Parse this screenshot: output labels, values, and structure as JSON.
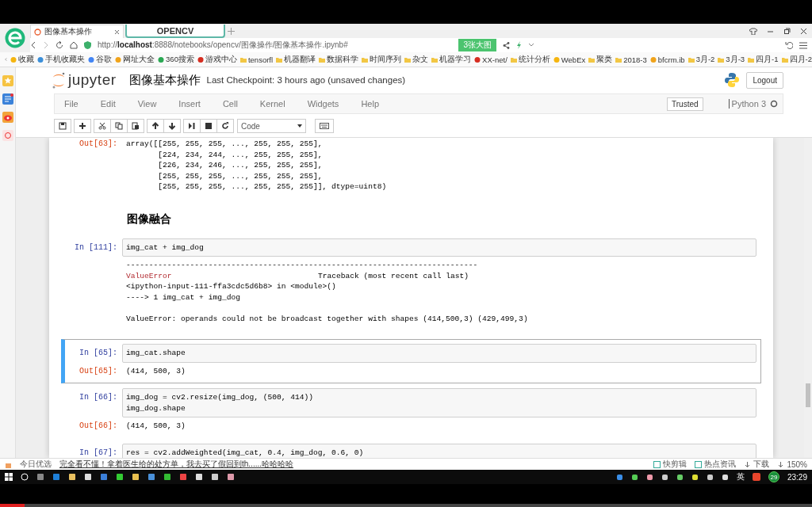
{
  "browser": {
    "tabs": [
      {
        "title": "图像基本操作",
        "selected": true
      }
    ],
    "overlay_label": "OPENCV",
    "url": "http://**localhost**:8888/notebooks/opencv/图像操作/图像基本操作.ipynb#",
    "badge": "3张大图",
    "bookmarks": [
      "收藏",
      "手机收藏夹",
      "谷歌",
      "网址大全",
      "360搜索",
      "游戏中心",
      "tensorfl",
      "机器翻译",
      "数据科学",
      "时间序列",
      "杂文",
      "机器学习",
      "XX-net/",
      "统计分析",
      "WebEx",
      "聚类",
      "2018-3",
      "bfcrm.ib",
      "3月-2",
      "3月-3",
      "四月-1",
      "四月-2"
    ]
  },
  "jupyter": {
    "logo_text": "jupyter",
    "notebook_title": "图像基本操作",
    "checkpoint": "Last Checkpoint: 3 hours ago (unsaved changes)",
    "logout": "Logout",
    "menu": [
      "File",
      "Edit",
      "View",
      "Insert",
      "Cell",
      "Kernel",
      "Widgets",
      "Help"
    ],
    "trusted": "Trusted",
    "kernel": "Python 3",
    "kernel_busy": false,
    "cell_type": "Code"
  },
  "cells": [
    {
      "kind": "code",
      "selected": false,
      "outputs": [
        {
          "kind": "result",
          "prompt": "Out[63]:",
          "lines": [
            "array([[255, 255, 255, ..., 255, 255, 255],",
            "       [224, 234, 244, ..., 255, 255, 255],",
            "       [226, 234, 246, ..., 255, 255, 255],",
            "       [255, 255, 255, ..., 255, 255, 255],",
            "       [255, 255, 255, ..., 255, 255, 255]], dtype=uint8)"
          ]
        }
      ]
    },
    {
      "kind": "markdown",
      "selected": false,
      "text": "图像融合"
    },
    {
      "kind": "code",
      "selected": false,
      "prompt": "In [111]:",
      "source": [
        "img_cat + img_dog"
      ],
      "outputs": [
        {
          "kind": "error",
          "rule": "-----------------------------------------------------------------------------",
          "ename": "ValueError",
          "header": "Traceback (most recent call last)",
          "lines": [
            "<ipython-input-111-ffa3cdc5d6b8> in <module>()",
            "----> 1 img_cat + img_dog"
          ],
          "message": "ValueError: operands could not be broadcast together with shapes (414,500,3) (429,499,3)"
        }
      ]
    },
    {
      "kind": "code",
      "selected": true,
      "prompt": "In [65]:",
      "source": [
        "img_cat.shape"
      ],
      "outputs": [
        {
          "kind": "result",
          "prompt": "Out[65]:",
          "lines": [
            "(414, 500, 3)"
          ]
        }
      ]
    },
    {
      "kind": "code",
      "selected": false,
      "prompt": "In [66]:",
      "source": [
        "img_dog = cv2.resize(img_dog, (500, 414))",
        "img_dog.shape"
      ],
      "outputs": [
        {
          "kind": "result",
          "prompt": "Out[66]:",
          "lines": [
            "(414, 500, 3)"
          ]
        }
      ]
    },
    {
      "kind": "code",
      "selected": false,
      "prompt": "In [67]:",
      "source": [
        "res = cv2.addWeighted(img_cat, 0.4, img_dog, 0.6, 0)"
      ]
    }
  ],
  "status_bar": {
    "left_label": "今日优选",
    "news": "完全看不懂！拿着医生给的处方单，我去买了假回到th......哈哈哈哈",
    "right_items": [
      "快剪辑",
      "热点资讯",
      "下载",
      "150%"
    ]
  },
  "taskbar": {
    "badge": "29",
    "language": "英",
    "time": "23:29"
  },
  "video_progress": {
    "level": 0.03
  }
}
